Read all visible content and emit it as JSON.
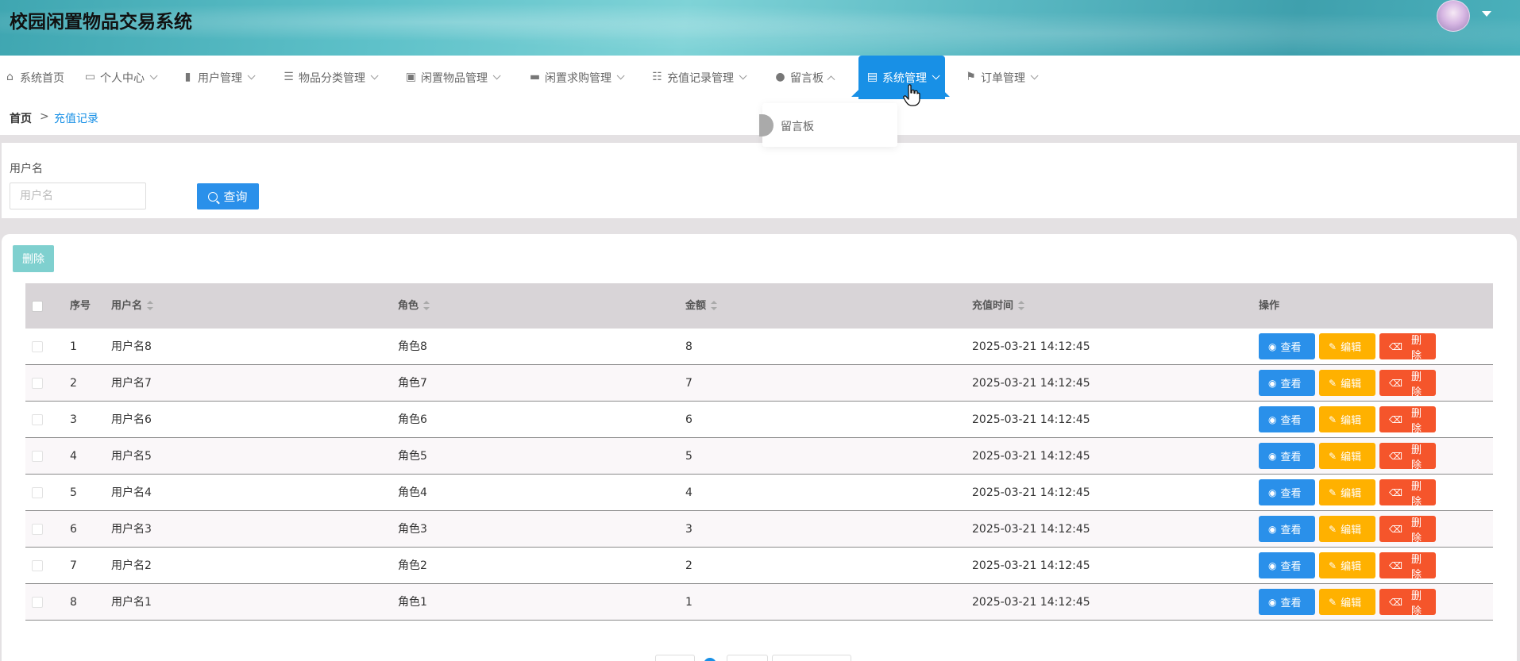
{
  "app": {
    "title": "校园闲置物品交易系统"
  },
  "nav": {
    "items": [
      {
        "label": "系统首页",
        "icon": "home-icon"
      },
      {
        "label": "个人中心",
        "icon": "card-icon"
      },
      {
        "label": "用户管理",
        "icon": "bar-chart-icon"
      },
      {
        "label": "物品分类管理",
        "icon": "list-icon"
      },
      {
        "label": "闲置物品管理",
        "icon": "briefcase-icon"
      },
      {
        "label": "闲置求购管理",
        "icon": "box-icon"
      },
      {
        "label": "充值记录管理",
        "icon": "sliders-icon"
      },
      {
        "label": "留言板",
        "icon": "user-icon"
      },
      {
        "label": "系统管理",
        "icon": "clipboard-icon",
        "active": true
      },
      {
        "label": "订单管理",
        "icon": "flag-icon"
      }
    ],
    "dropdown": {
      "item": "留言板"
    }
  },
  "breadcrumb": {
    "home": "首页",
    "separator": ">",
    "current": "充值记录"
  },
  "search": {
    "label": "用户名",
    "placeholder": "用户名",
    "value": "",
    "button": "查询"
  },
  "toolbar": {
    "delete": "删除"
  },
  "table": {
    "headers": {
      "index": "序号",
      "username": "用户名",
      "role": "角色",
      "amount": "金额",
      "time": "充值时间",
      "ops": "操作"
    },
    "rows": [
      {
        "index": "1",
        "username": "用户名8",
        "role": "角色8",
        "amount": "8",
        "time": "2025-03-21 14:12:45"
      },
      {
        "index": "2",
        "username": "用户名7",
        "role": "角色7",
        "amount": "7",
        "time": "2025-03-21 14:12:45"
      },
      {
        "index": "3",
        "username": "用户名6",
        "role": "角色6",
        "amount": "6",
        "time": "2025-03-21 14:12:45"
      },
      {
        "index": "4",
        "username": "用户名5",
        "role": "角色5",
        "amount": "5",
        "time": "2025-03-21 14:12:45"
      },
      {
        "index": "5",
        "username": "用户名4",
        "role": "角色4",
        "amount": "4",
        "time": "2025-03-21 14:12:45"
      },
      {
        "index": "6",
        "username": "用户名3",
        "role": "角色3",
        "amount": "3",
        "time": "2025-03-21 14:12:45"
      },
      {
        "index": "7",
        "username": "用户名2",
        "role": "角色2",
        "amount": "2",
        "time": "2025-03-21 14:12:45"
      },
      {
        "index": "8",
        "username": "用户名1",
        "role": "角色1",
        "amount": "1",
        "time": "2025-03-21 14:12:45"
      }
    ],
    "ops": {
      "view": "查看",
      "edit": "编辑",
      "delete": "删除"
    }
  },
  "colors": {
    "primary": "#1890e6",
    "warning": "#ffb100",
    "danger": "#f5552b",
    "teal": "#7fd0cf"
  }
}
